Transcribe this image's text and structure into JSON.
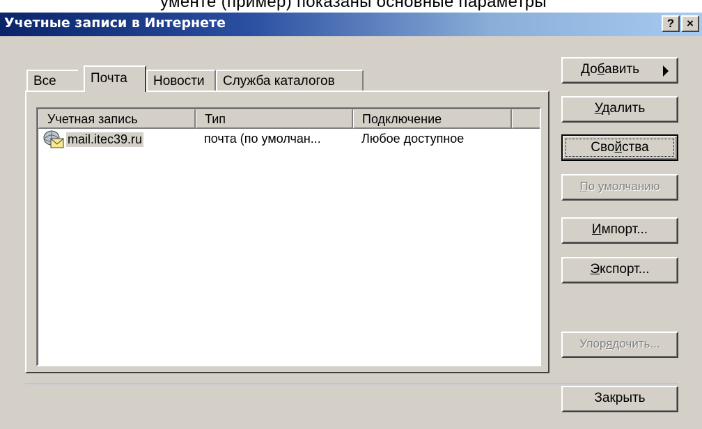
{
  "window": {
    "title": "Учетные записи в Интернете",
    "help_label": "?",
    "close_label": "×"
  },
  "top_strip": {
    "text": "ументе (пример) показаны основные параметры"
  },
  "tabs": [
    {
      "label": "Все",
      "active": false
    },
    {
      "label": "Почта",
      "active": true
    },
    {
      "label": "Новости",
      "active": false
    },
    {
      "label": "Служба каталогов",
      "active": false
    }
  ],
  "list": {
    "columns": [
      "Учетная запись",
      "Тип",
      "Подключение",
      ""
    ],
    "rows": [
      {
        "account": "mail.itec39.ru",
        "type": "почта (по умолчан...",
        "connection": "Любое доступное",
        "icon": "mail-account-icon"
      }
    ]
  },
  "buttons": {
    "add": {
      "pre": "До",
      "mnemonic": "б",
      "post": "авить",
      "enabled": true
    },
    "delete": {
      "pre": "",
      "mnemonic": "У",
      "post": "далить",
      "enabled": true
    },
    "properties": {
      "pre": "Сво",
      "mnemonic": "й",
      "post": "ства",
      "enabled": true,
      "focused": true
    },
    "default": {
      "pre": "",
      "mnemonic": "П",
      "post": "о умолчанию",
      "enabled": false
    },
    "import": {
      "pre": "",
      "mnemonic": "И",
      "post": "мпорт...",
      "enabled": true
    },
    "export": {
      "pre": "",
      "mnemonic": "Э",
      "post": "кспорт...",
      "enabled": true
    },
    "order": {
      "pre": "Упор",
      "mnemonic": "я",
      "post": "дочить...",
      "enabled": false
    },
    "close": {
      "label": "Закрыть",
      "enabled": true
    }
  }
}
